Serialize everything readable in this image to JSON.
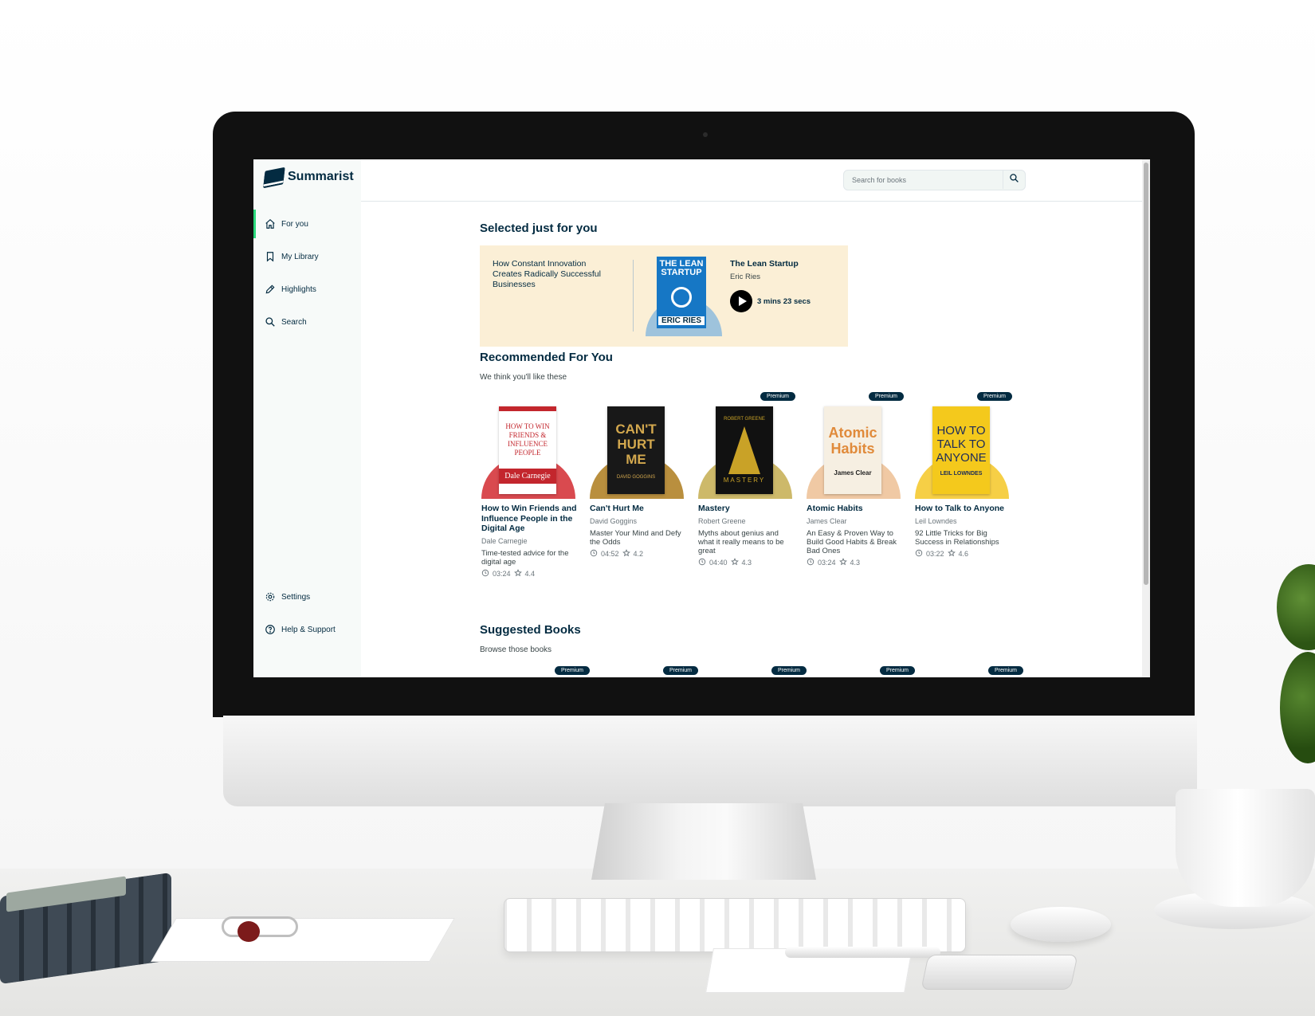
{
  "app": {
    "name": "Summarist"
  },
  "sidebar": {
    "items": [
      {
        "label": "For you",
        "icon": "home-icon",
        "active": true
      },
      {
        "label": "My Library",
        "icon": "bookmark-icon",
        "active": false
      },
      {
        "label": "Highlights",
        "icon": "pencil-icon",
        "active": false
      },
      {
        "label": "Search",
        "icon": "search-icon",
        "active": false
      }
    ],
    "bottom_items": [
      {
        "label": "Settings",
        "icon": "gear-icon"
      },
      {
        "label": "Help & Support",
        "icon": "help-icon"
      }
    ]
  },
  "search": {
    "placeholder": "Search for books",
    "value": ""
  },
  "selected": {
    "heading": "Selected just for you",
    "subtitle": "How Constant Innovation Creates Radically Successful Businesses",
    "title": "The Lean Startup",
    "author": "Eric Ries",
    "duration": "3 mins 23 secs",
    "cover_text_top": "THE LEAN STARTUP",
    "cover_text_bottom": "ERIC RIES"
  },
  "recommended": {
    "heading": "Recommended For You",
    "subheading": "We think you'll like these",
    "premium_label": "Premium",
    "books": [
      {
        "title": "How to Win Friends and Influence People in the Digital Age",
        "author": "Dale Carnegie",
        "subtitle": "Time-tested advice for the digital age",
        "duration": "03:24",
        "rating": "4.4",
        "premium": false,
        "cover_title": "HOW TO WIN FRIENDS & INFLUENCE PEOPLE",
        "cover_author": "Dale Carnegie",
        "arc_color": "#d94a4f",
        "cover_bg": "#ffffff",
        "cover_fg": "#c3262d"
      },
      {
        "title": "Can't Hurt Me",
        "author": "David Goggins",
        "subtitle": "Master Your Mind and Defy the Odds",
        "duration": "04:52",
        "rating": "4.2",
        "premium": false,
        "cover_title": "CAN'T HURT ME",
        "cover_author": "DAVID GOGGINS",
        "arc_color": "#b98f3e",
        "cover_bg": "#181818",
        "cover_fg": "#d3a84e"
      },
      {
        "title": "Mastery",
        "author": "Robert Greene",
        "subtitle": "Myths about genius and what it really means to be great",
        "duration": "04:40",
        "rating": "4.3",
        "premium": true,
        "cover_title": "MASTERY",
        "cover_author": "ROBERT GREENE",
        "arc_color": "#cdb96a",
        "cover_bg": "#111111",
        "cover_fg": "#c9a227"
      },
      {
        "title": "Atomic Habits",
        "author": "James Clear",
        "subtitle": "An Easy & Proven Way to Build Good Habits & Break Bad Ones",
        "duration": "03:24",
        "rating": "4.3",
        "premium": true,
        "cover_title": "Atomic Habits",
        "cover_author": "James Clear",
        "arc_color": "#f0c9a4",
        "cover_bg": "#f6efe2",
        "cover_fg": "#e08a3a"
      },
      {
        "title": "How to Talk to Anyone",
        "author": "Leil Lowndes",
        "subtitle": "92 Little Tricks for Big Success in Relationships",
        "duration": "03:22",
        "rating": "4.6",
        "premium": true,
        "cover_title": "HOW TO TALK TO ANYONE",
        "cover_author": "LEIL LOWNDES",
        "arc_color": "#f6cf46",
        "cover_bg": "#f4c91c",
        "cover_fg": "#1c2b5a"
      }
    ]
  },
  "suggested": {
    "heading": "Suggested Books",
    "subheading": "Browse those books"
  },
  "colors": {
    "brand": "#032b41",
    "accent": "#2bd97c",
    "card_bg": "#fbefd6",
    "sidebar_bg": "#f7faf9"
  }
}
